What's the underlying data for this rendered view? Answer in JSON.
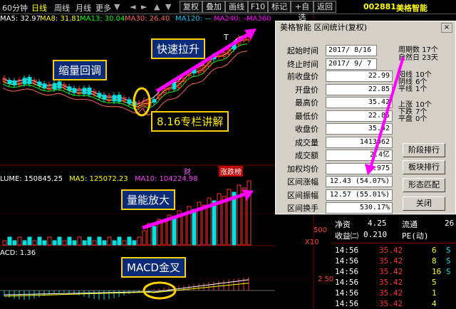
{
  "toolbar": {
    "period": "60分钟",
    "daily": "日线",
    "weekly": "周线",
    "monthly": "月线",
    "more": "更多",
    "buttons": [
      "复权",
      "叠加",
      "画线",
      "F10",
      "标记",
      "+自选",
      "返回"
    ],
    "stock_code": "002881",
    "stock_name": "美格智能"
  },
  "ma_legend": [
    {
      "label": "MA5: 32.97",
      "color": "#ffffff"
    },
    {
      "label": "MA8: 31.81",
      "color": "#ffff00"
    },
    {
      "label": "MA13: 30.04",
      "color": "#00ff00"
    },
    {
      "label": "MA30: 26.40",
      "color": "#ff6060"
    },
    {
      "label": "MA120: —",
      "color": "#00c8ff"
    },
    {
      "label": "MA240: —",
      "color": "#ff00ff"
    },
    {
      "label": "MA360",
      "color": "#ff00ff"
    }
  ],
  "volume_legend": {
    "vol": "LUME: 150845.25",
    "ma5": "MA5: 125072.23",
    "ma10": "MA10: 104224.98"
  },
  "macd_legend": "ACD: 1.36",
  "markers": {
    "cai": "财",
    "zhang": "涨跌榜"
  },
  "annotations": {
    "shrink": "缩量回调",
    "rise": "快速拉升",
    "column": "8.16专栏讲解",
    "volume": "量能放大",
    "macd": "MACD金叉"
  },
  "axis_labels": {
    "top": "T",
    "vol_ticks": [
      "500",
      "X10"
    ],
    "macd_ticks": [
      "2.50"
    ]
  },
  "dialog": {
    "title": "美格智能 区间统计(复权)",
    "close": "×",
    "start_label": "起始时间",
    "start_value": "2017/ 8/16",
    "end_label": "终止时间",
    "end_value": "2017/ 9/ 7",
    "rows": [
      {
        "label": "前收盘价",
        "value": "22.99"
      },
      {
        "label": "开盘价",
        "value": "22.85"
      },
      {
        "label": "最高价",
        "value": "35.42"
      },
      {
        "label": "最低价",
        "value": "22.85"
      },
      {
        "label": "收盘价",
        "value": "35.42"
      },
      {
        "label": "成交量",
        "value": "1413962"
      },
      {
        "label": "成交额",
        "value": "2.4亿"
      },
      {
        "label": "加权均价",
        "value": "9.975"
      },
      {
        "label": "区间涨幅",
        "value": "12.43 (54.07%)"
      },
      {
        "label": "区间振幅",
        "value": "12.57 (55.01%)"
      },
      {
        "label": "区间换手",
        "value": "530.17%"
      }
    ],
    "period_count_label": "周期数",
    "period_count_value": "17个",
    "day_count_label": "自然日",
    "day_count_value": "23天",
    "stats": [
      {
        "label": "阳线",
        "value": "10个"
      },
      {
        "label": "阴线",
        "value": "6个"
      },
      {
        "label": "平线",
        "value": "1个"
      },
      {
        "label": "上涨",
        "value": "10个"
      },
      {
        "label": "下跌",
        "value": "7个"
      },
      {
        "label": "平盘",
        "value": "0个"
      }
    ],
    "buttons": [
      "阶段排行",
      "板块排行",
      "形态匹配",
      "关闭"
    ]
  },
  "quote": {
    "net_asset_label": "净资",
    "net_asset_value": "4.25",
    "float_label": "流通",
    "float_value": "26",
    "eps_label": "收益㈡",
    "eps_value": "0.210",
    "pe_label": "PE(动)",
    "ticks": [
      {
        "time": "14:56",
        "price": "35.42",
        "vol": "6",
        "side": "S"
      },
      {
        "time": "14:56",
        "price": "35.42",
        "vol": "8",
        "side": "S"
      },
      {
        "time": "14:56",
        "price": "35.42",
        "vol": "16",
        "side": "S"
      },
      {
        "time": "14:56",
        "price": "35.42",
        "vol": "5",
        "side": ""
      },
      {
        "time": "14:56",
        "price": "35.42",
        "vol": "1",
        "side": ""
      },
      {
        "time": "14:56",
        "price": "35.42",
        "vol": "4",
        "side": ""
      }
    ]
  },
  "colors": {
    "up": "#ff3030",
    "down": "#00e0e0",
    "accent": "#ff00ff",
    "highlight": "#ffd000"
  }
}
